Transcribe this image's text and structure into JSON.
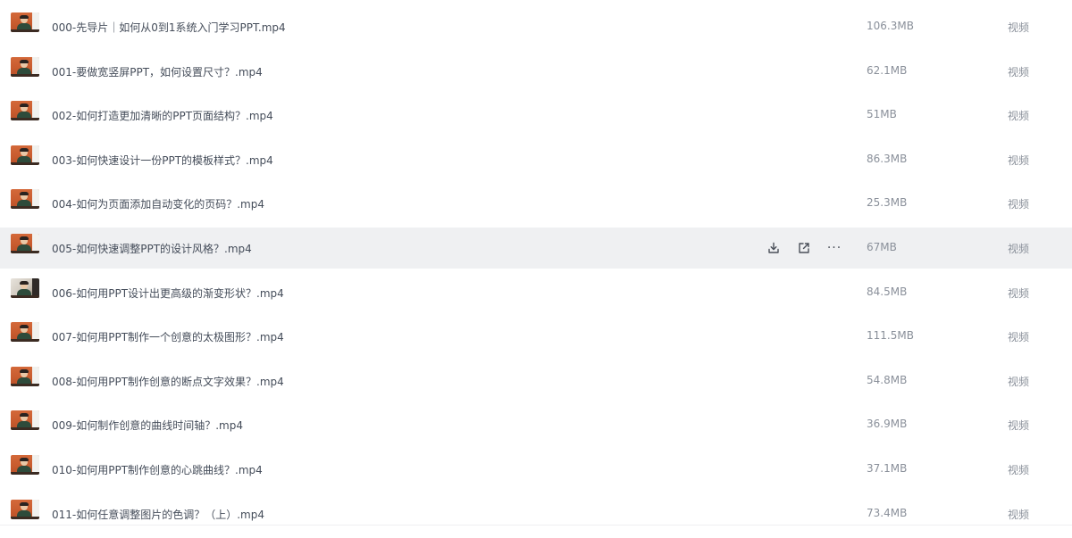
{
  "files": [
    {
      "name": "000-先导片｜如何从0到1系统入门学习PPT.mp4",
      "size": "106.3MB",
      "type": "视频",
      "thumb": "default"
    },
    {
      "name": "001-要做宽竖屏PPT，如何设置尺寸？.mp4",
      "size": "62.1MB",
      "type": "视频",
      "thumb": "default"
    },
    {
      "name": "002-如何打造更加清晰的PPT页面结构？.mp4",
      "size": "51MB",
      "type": "视频",
      "thumb": "default"
    },
    {
      "name": "003-如何快速设计一份PPT的模板样式？.mp4",
      "size": "86.3MB",
      "type": "视频",
      "thumb": "default"
    },
    {
      "name": "004-如何为页面添加自动变化的页码？.mp4",
      "size": "25.3MB",
      "type": "视频",
      "thumb": "default"
    },
    {
      "name": "005-如何快速调整PPT的设计风格？.mp4",
      "size": "67MB",
      "type": "视频",
      "thumb": "default",
      "hovered": true
    },
    {
      "name": "006-如何用PPT设计出更高级的渐变形状？.mp4",
      "size": "84.5MB",
      "type": "视频",
      "thumb": "alt"
    },
    {
      "name": "007-如何用PPT制作一个创意的太极图形？.mp4",
      "size": "111.5MB",
      "type": "视频",
      "thumb": "default"
    },
    {
      "name": "008-如何用PPT制作创意的断点文字效果？.mp4",
      "size": "54.8MB",
      "type": "视频",
      "thumb": "default"
    },
    {
      "name": "009-如何制作创意的曲线时间轴？.mp4",
      "size": "36.9MB",
      "type": "视频",
      "thumb": "default"
    },
    {
      "name": "010-如何用PPT制作创意的心跳曲线？.mp4",
      "size": "37.1MB",
      "type": "视频",
      "thumb": "default"
    },
    {
      "name": "011-如何任意调整图片的色调？（上）.mp4",
      "size": "73.4MB",
      "type": "视频",
      "thumb": "default"
    }
  ],
  "row_actions": {
    "download_icon": "download-icon",
    "share_icon": "share-icon",
    "more_icon": "more-icon",
    "more_label": "···"
  },
  "colors": {
    "hover_bg": "#eff0f2",
    "name_text": "#454d5a",
    "meta_text": "#8a909a"
  }
}
